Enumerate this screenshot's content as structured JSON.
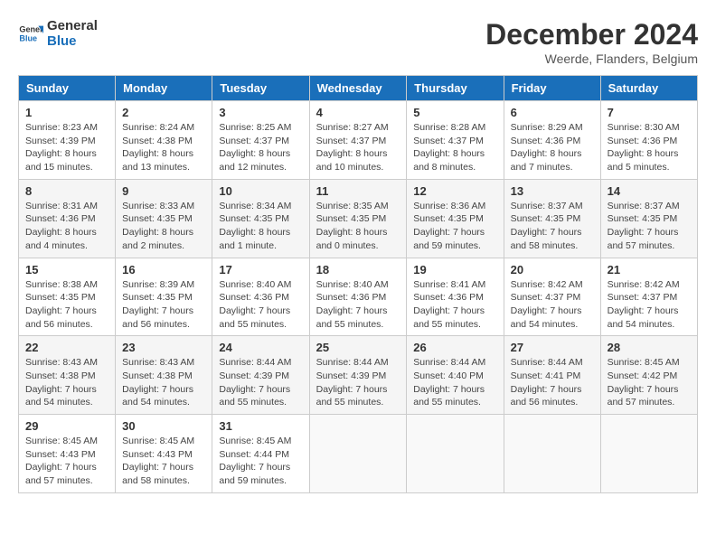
{
  "logo": {
    "line1": "General",
    "line2": "Blue"
  },
  "title": "December 2024",
  "subtitle": "Weerde, Flanders, Belgium",
  "days_header": [
    "Sunday",
    "Monday",
    "Tuesday",
    "Wednesday",
    "Thursday",
    "Friday",
    "Saturday"
  ],
  "weeks": [
    [
      {
        "num": "1",
        "sunrise": "Sunrise: 8:23 AM",
        "sunset": "Sunset: 4:39 PM",
        "daylight": "Daylight: 8 hours and 15 minutes."
      },
      {
        "num": "2",
        "sunrise": "Sunrise: 8:24 AM",
        "sunset": "Sunset: 4:38 PM",
        "daylight": "Daylight: 8 hours and 13 minutes."
      },
      {
        "num": "3",
        "sunrise": "Sunrise: 8:25 AM",
        "sunset": "Sunset: 4:37 PM",
        "daylight": "Daylight: 8 hours and 12 minutes."
      },
      {
        "num": "4",
        "sunrise": "Sunrise: 8:27 AM",
        "sunset": "Sunset: 4:37 PM",
        "daylight": "Daylight: 8 hours and 10 minutes."
      },
      {
        "num": "5",
        "sunrise": "Sunrise: 8:28 AM",
        "sunset": "Sunset: 4:37 PM",
        "daylight": "Daylight: 8 hours and 8 minutes."
      },
      {
        "num": "6",
        "sunrise": "Sunrise: 8:29 AM",
        "sunset": "Sunset: 4:36 PM",
        "daylight": "Daylight: 8 hours and 7 minutes."
      },
      {
        "num": "7",
        "sunrise": "Sunrise: 8:30 AM",
        "sunset": "Sunset: 4:36 PM",
        "daylight": "Daylight: 8 hours and 5 minutes."
      }
    ],
    [
      {
        "num": "8",
        "sunrise": "Sunrise: 8:31 AM",
        "sunset": "Sunset: 4:36 PM",
        "daylight": "Daylight: 8 hours and 4 minutes."
      },
      {
        "num": "9",
        "sunrise": "Sunrise: 8:33 AM",
        "sunset": "Sunset: 4:35 PM",
        "daylight": "Daylight: 8 hours and 2 minutes."
      },
      {
        "num": "10",
        "sunrise": "Sunrise: 8:34 AM",
        "sunset": "Sunset: 4:35 PM",
        "daylight": "Daylight: 8 hours and 1 minute."
      },
      {
        "num": "11",
        "sunrise": "Sunrise: 8:35 AM",
        "sunset": "Sunset: 4:35 PM",
        "daylight": "Daylight: 8 hours and 0 minutes."
      },
      {
        "num": "12",
        "sunrise": "Sunrise: 8:36 AM",
        "sunset": "Sunset: 4:35 PM",
        "daylight": "Daylight: 7 hours and 59 minutes."
      },
      {
        "num": "13",
        "sunrise": "Sunrise: 8:37 AM",
        "sunset": "Sunset: 4:35 PM",
        "daylight": "Daylight: 7 hours and 58 minutes."
      },
      {
        "num": "14",
        "sunrise": "Sunrise: 8:37 AM",
        "sunset": "Sunset: 4:35 PM",
        "daylight": "Daylight: 7 hours and 57 minutes."
      }
    ],
    [
      {
        "num": "15",
        "sunrise": "Sunrise: 8:38 AM",
        "sunset": "Sunset: 4:35 PM",
        "daylight": "Daylight: 7 hours and 56 minutes."
      },
      {
        "num": "16",
        "sunrise": "Sunrise: 8:39 AM",
        "sunset": "Sunset: 4:35 PM",
        "daylight": "Daylight: 7 hours and 56 minutes."
      },
      {
        "num": "17",
        "sunrise": "Sunrise: 8:40 AM",
        "sunset": "Sunset: 4:36 PM",
        "daylight": "Daylight: 7 hours and 55 minutes."
      },
      {
        "num": "18",
        "sunrise": "Sunrise: 8:40 AM",
        "sunset": "Sunset: 4:36 PM",
        "daylight": "Daylight: 7 hours and 55 minutes."
      },
      {
        "num": "19",
        "sunrise": "Sunrise: 8:41 AM",
        "sunset": "Sunset: 4:36 PM",
        "daylight": "Daylight: 7 hours and 55 minutes."
      },
      {
        "num": "20",
        "sunrise": "Sunrise: 8:42 AM",
        "sunset": "Sunset: 4:37 PM",
        "daylight": "Daylight: 7 hours and 54 minutes."
      },
      {
        "num": "21",
        "sunrise": "Sunrise: 8:42 AM",
        "sunset": "Sunset: 4:37 PM",
        "daylight": "Daylight: 7 hours and 54 minutes."
      }
    ],
    [
      {
        "num": "22",
        "sunrise": "Sunrise: 8:43 AM",
        "sunset": "Sunset: 4:38 PM",
        "daylight": "Daylight: 7 hours and 54 minutes."
      },
      {
        "num": "23",
        "sunrise": "Sunrise: 8:43 AM",
        "sunset": "Sunset: 4:38 PM",
        "daylight": "Daylight: 7 hours and 54 minutes."
      },
      {
        "num": "24",
        "sunrise": "Sunrise: 8:44 AM",
        "sunset": "Sunset: 4:39 PM",
        "daylight": "Daylight: 7 hours and 55 minutes."
      },
      {
        "num": "25",
        "sunrise": "Sunrise: 8:44 AM",
        "sunset": "Sunset: 4:39 PM",
        "daylight": "Daylight: 7 hours and 55 minutes."
      },
      {
        "num": "26",
        "sunrise": "Sunrise: 8:44 AM",
        "sunset": "Sunset: 4:40 PM",
        "daylight": "Daylight: 7 hours and 55 minutes."
      },
      {
        "num": "27",
        "sunrise": "Sunrise: 8:44 AM",
        "sunset": "Sunset: 4:41 PM",
        "daylight": "Daylight: 7 hours and 56 minutes."
      },
      {
        "num": "28",
        "sunrise": "Sunrise: 8:45 AM",
        "sunset": "Sunset: 4:42 PM",
        "daylight": "Daylight: 7 hours and 57 minutes."
      }
    ],
    [
      {
        "num": "29",
        "sunrise": "Sunrise: 8:45 AM",
        "sunset": "Sunset: 4:43 PM",
        "daylight": "Daylight: 7 hours and 57 minutes."
      },
      {
        "num": "30",
        "sunrise": "Sunrise: 8:45 AM",
        "sunset": "Sunset: 4:43 PM",
        "daylight": "Daylight: 7 hours and 58 minutes."
      },
      {
        "num": "31",
        "sunrise": "Sunrise: 8:45 AM",
        "sunset": "Sunset: 4:44 PM",
        "daylight": "Daylight: 7 hours and 59 minutes."
      },
      null,
      null,
      null,
      null
    ]
  ]
}
